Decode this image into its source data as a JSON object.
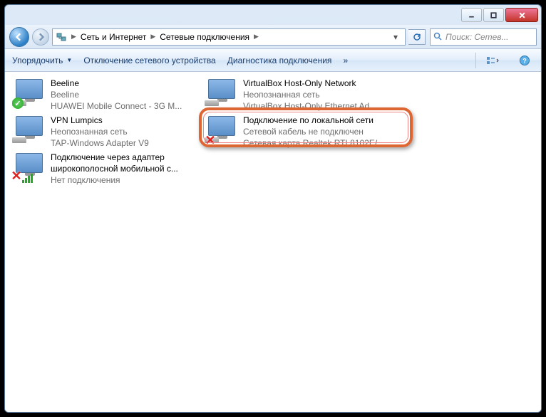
{
  "breadcrumb": {
    "part1": "Сеть и Интернет",
    "part2": "Сетевые подключения"
  },
  "search": {
    "placeholder": "Поиск: Сетев..."
  },
  "toolbar": {
    "organize": "Упорядочить",
    "disable": "Отключение сетевого устройства",
    "diagnose": "Диагностика подключения",
    "more": "»"
  },
  "connections": [
    {
      "name": "Beeline",
      "line2": "Beeline",
      "line3": "HUAWEI Mobile Connect - 3G M...",
      "badge": "ok"
    },
    {
      "name": "VirtualBox Host-Only Network",
      "line2": "Неопознанная сеть",
      "line3": "VirtualBox Host-Only Ethernet Ad...",
      "badge": "none"
    },
    {
      "name": "VPN Lumpics",
      "line2": "Неопознанная сеть",
      "line3": "TAP-Windows Adapter V9",
      "badge": "none"
    },
    {
      "name": "Подключение по локальной сети",
      "line2": "Сетевой кабель не подключен",
      "line3": "Сетевая карта Realtek RTL8102E/...",
      "badge": "x",
      "highlighted": true
    },
    {
      "name": "Подключение через адаптер широкополосной мобильной с...",
      "line2": "Нет подключения",
      "line3": "",
      "badge": "bars-x"
    }
  ]
}
